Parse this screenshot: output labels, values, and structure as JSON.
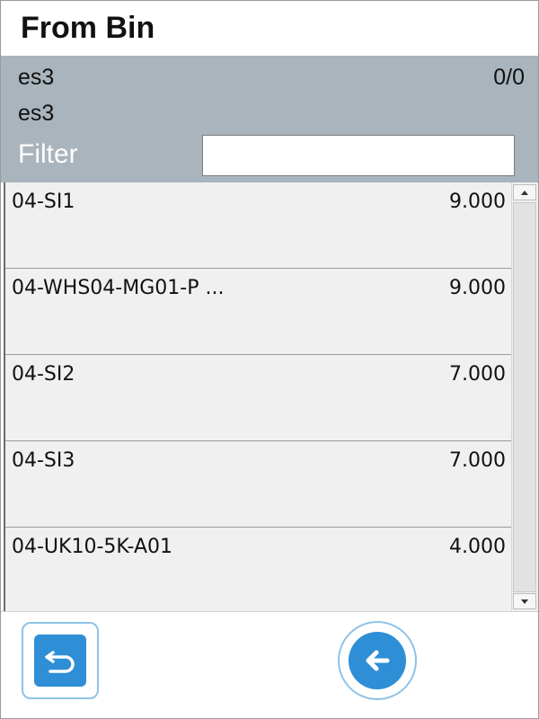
{
  "header": {
    "title": "From Bin"
  },
  "info": {
    "line1": "es3",
    "line2": "es3",
    "counter": "0/0",
    "filter_label": "Filter",
    "filter_value": ""
  },
  "bins": [
    {
      "name": "04-SI1",
      "qty": "9.000"
    },
    {
      "name": "04-WHS04-MG01-P ...",
      "qty": "9.000"
    },
    {
      "name": "04-SI2",
      "qty": "7.000"
    },
    {
      "name": "04-SI3",
      "qty": "7.000"
    },
    {
      "name": "04-UK10-5K-A01",
      "qty": "4.000"
    }
  ],
  "footer": {
    "undo_icon": "undo-icon",
    "back_icon": "arrow-left-icon"
  },
  "colors": {
    "header_panel": "#a9b4bc",
    "list_background": "#f0f0f0",
    "button_blue": "#2e8ed6",
    "button_border": "#8ec3e8"
  }
}
